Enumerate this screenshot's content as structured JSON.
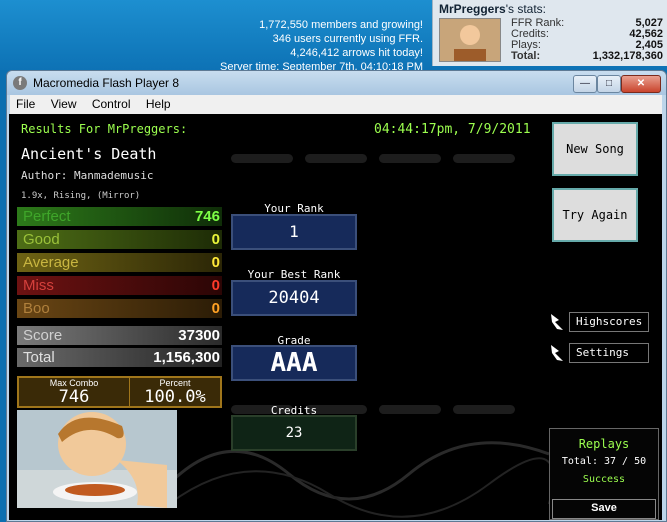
{
  "site": {
    "members_line": "1,772,550 members and growing!",
    "users_line": "346 users currently using FFR.",
    "arrows_line": "4,246,412 arrows hit today!",
    "server_time_line": "Server time: September 7th, 04:10:18 PM",
    "stats_user": "MrPreggers",
    "stats_suffix": "'s stats:",
    "stats": [
      {
        "label": "FFR Rank:",
        "value": "5,027"
      },
      {
        "label": "Credits:",
        "value": "42,562"
      },
      {
        "label": "Plays:",
        "value": "2,405"
      },
      {
        "label": "Total:",
        "value": "1,332,178,360"
      }
    ]
  },
  "window": {
    "icon_letter": "f",
    "title": "Macromedia Flash Player 8",
    "min_glyph": "—",
    "max_glyph": "□",
    "close_glyph": "✕",
    "menu": [
      "File",
      "View",
      "Control",
      "Help"
    ]
  },
  "game": {
    "results_for": "Results For MrPreggers:",
    "timestamp": "04:44:17pm, 7/9/2011",
    "song_title": "Ancient's Death",
    "author": "Author: Manmademusic",
    "mods": "1.9x, Rising, (Mirror)",
    "judgements": [
      {
        "label": "Perfect",
        "value": "746",
        "bg": "#1f5a12",
        "fg": "#3fa62a",
        "vcolor": "#7dff46"
      },
      {
        "label": "Good",
        "value": "0",
        "bg": "#3b5b10",
        "fg": "#9bc23a",
        "vcolor": "#e8f53a"
      },
      {
        "label": "Average",
        "value": "0",
        "bg": "#59500f",
        "fg": "#c9b641",
        "vcolor": "#ffe83a"
      },
      {
        "label": "Miss",
        "value": "0",
        "bg": "#5a0d0d",
        "fg": "#d4403c",
        "vcolor": "#ff3a2a"
      },
      {
        "label": "Boo",
        "value": "0",
        "bg": "#4e350f",
        "fg": "#b0803c",
        "vcolor": "#ffa124"
      },
      {
        "label": "Score",
        "value": "37300",
        "bg": "#5a5a5a",
        "fg": "#c8c8c8",
        "vcolor": "#ffffff"
      },
      {
        "label": "Total",
        "value": "1,156,300",
        "bg": "#4a4a4a",
        "fg": "#d8d8d8",
        "vcolor": "#ffffff"
      }
    ],
    "max_combo_label": "Max Combo",
    "max_combo": "746",
    "percent_label": "Percent",
    "percent": "100.0%",
    "your_rank_label": "Your Rank",
    "your_rank": "1",
    "best_rank_label": "Your Best Rank",
    "best_rank": "20404",
    "grade_label": "Grade",
    "grade": "AAA",
    "credits_label": "Credits",
    "credits": "23",
    "new_song": "New Song",
    "try_again": "Try Again",
    "highscores": "Highscores",
    "settings": "Settings",
    "replays_title": "Replays",
    "replays_total": "Total: 37 / 50",
    "replays_status": "Success",
    "save": "Save"
  },
  "colors": {
    "accent_green": "#9cff4f",
    "window_blue": "#bcd5ea"
  }
}
